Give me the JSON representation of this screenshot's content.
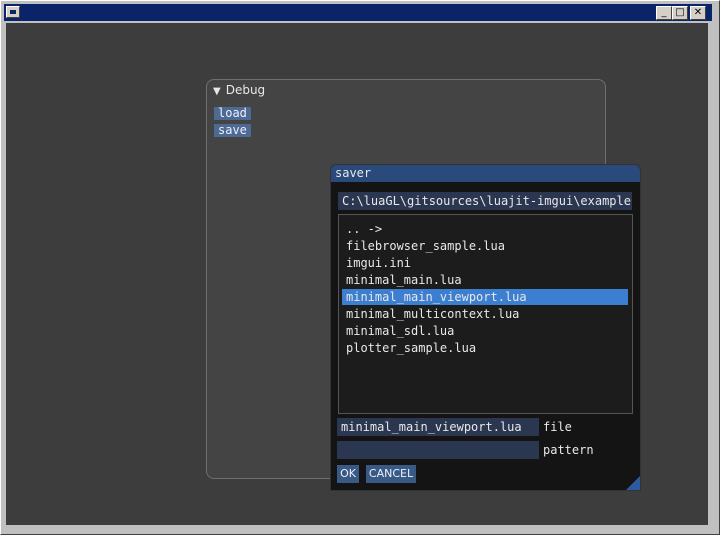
{
  "colors": {
    "titlebar": "#0a246a",
    "client_bg": "#3d3d3d",
    "imgui_button": "#4d6a92",
    "selected_item": "#3c7fd1",
    "popup_title": "#294a7a"
  },
  "titlebar": {
    "icons": [
      "window-icon"
    ],
    "controls": [
      "minimize-icon",
      "maximize-icon",
      "close-icon"
    ],
    "control_glyphs": [
      "_",
      "□",
      "✕"
    ]
  },
  "debug_window": {
    "title": "Debug",
    "buttons": [
      {
        "label": "load"
      },
      {
        "label": "save"
      }
    ]
  },
  "saver": {
    "title": "saver",
    "path": "C:\\luaGL\\gitsources\\luajit-imgui\\examples",
    "files": [
      ".. ->",
      "filebrowser_sample.lua",
      "imgui.ini",
      "minimal_main.lua",
      "minimal_main_viewport.lua",
      "minimal_multicontext.lua",
      "minimal_sdl.lua",
      "plotter_sample.lua"
    ],
    "selected_file": "minimal_main_viewport.lua",
    "file_value": "minimal_main_viewport.lua",
    "file_label": "file",
    "pattern_value": "",
    "pattern_label": "pattern",
    "ok_label": "OK",
    "cancel_label": "CANCEL"
  }
}
